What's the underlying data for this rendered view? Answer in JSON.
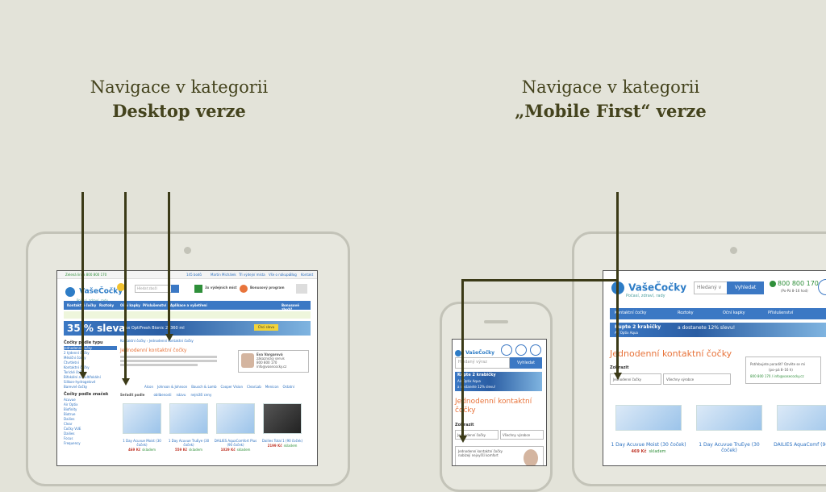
{
  "headings": {
    "left_line1": "Navigace v kategorii",
    "left_line2": "Desktop verze",
    "right_line1": "Navigace v kategorii",
    "right_line2": "„Mobile First“ verze"
  },
  "desktop": {
    "topbar_phone": "Zelená linka 800 800 170",
    "topbar_links": [
      "145 bodů",
      "Martin Michálek",
      "Tři výdejní místa",
      "Vše o nákupu",
      "Blog",
      "Kontakt"
    ],
    "logo": "VašeČočky",
    "logo_tagline": "Počasí, zdraví, rady",
    "search_placeholder": "Hledat zboží",
    "promo1": "3x výdejních míst",
    "promo2": "Bonusový program",
    "nav": [
      "Kontaktní čočky",
      "Roztoky",
      "Oční kapky",
      "Příslušenství",
      "Aplikace a vyšetření"
    ],
    "nav_right": "Bonusové zboží!",
    "banner_big": "35 % sleva",
    "banner_text": "Max OptiFresh Bionic 2x360 ml",
    "banner_btn": "Chci slevu",
    "sidebar_title": "Čočky podle typu",
    "sidebar_items": [
      "Jednodenní čočky",
      "2 týdenní čočky",
      "Měsíční čočky",
      "Čtvrtletní",
      "Kontaktní čočky",
      "Torické čočky",
      "Bifokální a multifokální",
      "Silikon-hydrogelové",
      "Barevné čočky"
    ],
    "sidebar_title2": "Čočky podle značek",
    "sidebar_brands": [
      "Acuvue",
      "Air Optix",
      "Biofinity",
      "Biotrue",
      "Dailies",
      "Clear",
      "Čočky VUE",
      "Dailies",
      "Focus",
      "Frequency"
    ],
    "breadcrumb": "Kontaktní čočky › Jednodenní kontaktní čočky",
    "page_title": "Jednodenní kontaktní čočky",
    "brands_filter": [
      "Alcon",
      "Johnson & Johnson",
      "Bausch & Lomb",
      "Cooper Vision",
      "ClearLab",
      "Menicon",
      "Ostatní"
    ],
    "sort_label": "Seřadit podle",
    "sort_options": [
      "oblíbenosti",
      "názvu",
      "nejnižší ceny"
    ],
    "advisor_name": "Eva Vargarová",
    "advisor_role": "zákaznický servis",
    "advisor_phone": "800 800 170",
    "advisor_email": "info@vasecocky.cz",
    "products": [
      {
        "name": "1 Day Acuvue Moist (30 čoček)",
        "price": "469 Kč",
        "stock": "skladem"
      },
      {
        "name": "1 Day Acuvue TruEye (30 čoček)",
        "price": "559 Kč",
        "stock": "skladem"
      },
      {
        "name": "DAILIES AquaComfort Plus (90 čoček)",
        "price": "1029 Kč",
        "stock": "skladem"
      },
      {
        "name": "Dailies Total 1 (90 čoček)",
        "price": "2199 Kč",
        "stock": "skladem"
      }
    ]
  },
  "phone": {
    "logo": "VašeČočky",
    "search_placeholder": "Hledaný výraz",
    "search_btn": "Vyhledat",
    "banner_line1": "Kupte 2 krabičky",
    "banner_line2": "Air Optix Aqua",
    "banner_line3": "a dostanete 12% slevu!",
    "page_title": "Jednodenní kontaktní čočky",
    "filter_label": "Zobrazit",
    "select1": "Jednodenní čočky",
    "select2": "Všechny výrobce",
    "advisor_text": "Jednodenní kontaktní čočky nabízejí nejvyšší komfort"
  },
  "tablet": {
    "logo": "VašeČočky",
    "logo_tagline": "Počasí, zdraví, rady",
    "search_placeholder": "Hledaný v",
    "search_btn": "Vyhledat",
    "phone": "800 800 170",
    "phone_hours": "(Po-Pá 8–16 hod)",
    "nav": [
      "Kontaktní čočky",
      "Roztoky",
      "Oční kapky",
      "Příslušenství"
    ],
    "banner_line1": "Kupte 2 krabičky",
    "banner_line2": "Air Optix Aqua",
    "banner_line3": "a dostanete 12% slevu!",
    "page_title": "Jednodenní kontaktní čočky",
    "filter_label": "Zobrazit",
    "select1": "Jednodenní čočky",
    "select2": "Všechny výrobce",
    "help_text": "Potřebujete poradit? Ozvěte se mi",
    "help_hours": "(po–pá 8–16 h)",
    "help_contact": "800 800 170 / info@vasecocky.cz",
    "products": [
      {
        "name": "1 Day Acuvue Moist (30 čoček)",
        "price": "469 Kč",
        "stock": "skladem"
      },
      {
        "name": "1 Day Acuvue TruEye (30 čoček)",
        "price": "",
        "stock": ""
      },
      {
        "name": "DAILIES AquaComf (90 čoček)",
        "price": "",
        "stock": ""
      }
    ]
  },
  "colors": {
    "line": "#3b3a17",
    "heading": "#44431d",
    "background": "#e3e3d9",
    "accent": "#e8743b",
    "brand": "#3b78c4"
  }
}
